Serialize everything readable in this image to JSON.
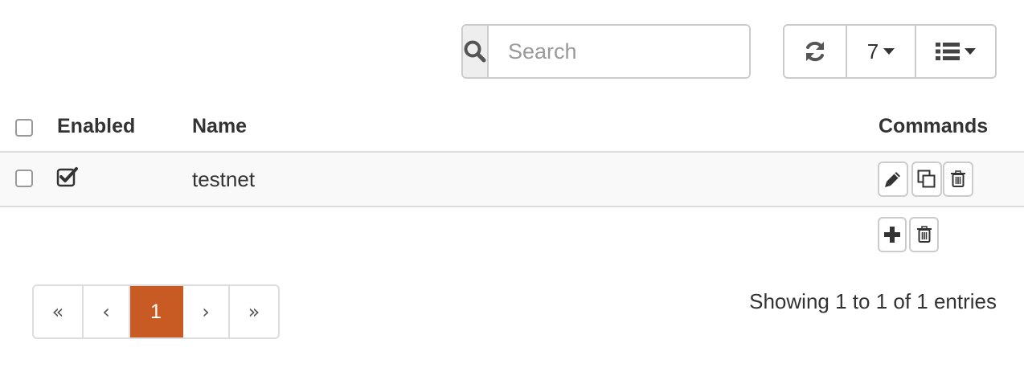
{
  "search": {
    "placeholder": "Search",
    "value": ""
  },
  "toolbar": {
    "refresh_icon": "refresh-icon",
    "rows_per_page": "7",
    "columns_icon": "list-icon"
  },
  "table": {
    "headers": {
      "enabled": "Enabled",
      "name": "Name",
      "commands": "Commands"
    },
    "rows": [
      {
        "selected": false,
        "enabled": true,
        "name": "testnet",
        "commands": [
          "edit",
          "copy",
          "delete"
        ]
      }
    ],
    "footer_commands": [
      "add",
      "delete"
    ]
  },
  "pagination": {
    "first": "«",
    "prev": "‹",
    "current": "1",
    "next": "›",
    "last": "»"
  },
  "info": "Showing 1 to 1 of 1 entries",
  "colors": {
    "accent": "#c85a24",
    "border": "#cccccc",
    "row_bg": "#f9f9f9"
  }
}
